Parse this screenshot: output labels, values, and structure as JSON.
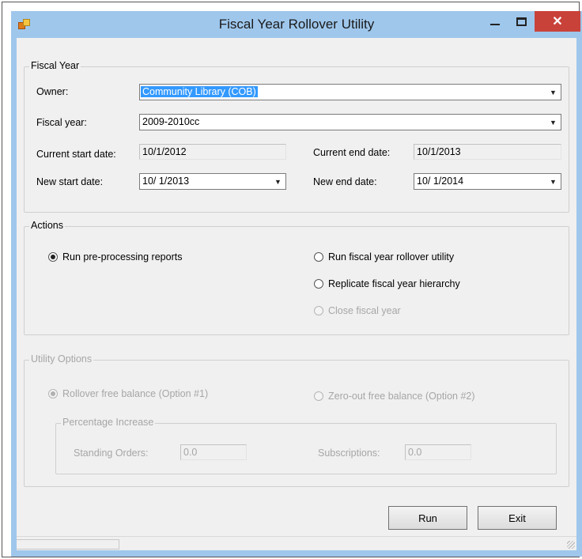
{
  "window": {
    "title": "Fiscal Year Rollover Utility",
    "close_glyph": "✕"
  },
  "fiscal_year": {
    "group_label": "Fiscal Year",
    "owner_label": "Owner:",
    "owner_value": "Community Library  (COB)",
    "fiscal_year_label": "Fiscal year:",
    "fiscal_year_value": "2009-2010cc",
    "current_start_label": "Current start date:",
    "current_start_value": "10/1/2012",
    "current_end_label": "Current end date:",
    "current_end_value": "10/1/2013",
    "new_start_label": "New start date:",
    "new_start_value": "10/  1/2013",
    "new_end_label": "New end date:",
    "new_end_value": "10/  1/2014"
  },
  "actions": {
    "group_label": "Actions",
    "run_preprocessing": "Run pre-processing reports",
    "run_rollover": "Run fiscal year rollover utility",
    "replicate": "Replicate fiscal year hierarchy",
    "close_fy": "Close fiscal year"
  },
  "utility_options": {
    "group_label": "Utility Options",
    "rollover_free": "Rollover free balance (Option #1)",
    "zero_out_free": "Zero-out free balance (Option #2)",
    "percentage_label": "Percentage Increase",
    "standing_orders_label": "Standing Orders:",
    "standing_orders_value": "0.0",
    "subscriptions_label": "Subscriptions:",
    "subscriptions_value": "0.0"
  },
  "buttons": {
    "run": "Run",
    "exit": "Exit"
  },
  "icons": {
    "dropdown_arrow": "▼"
  }
}
